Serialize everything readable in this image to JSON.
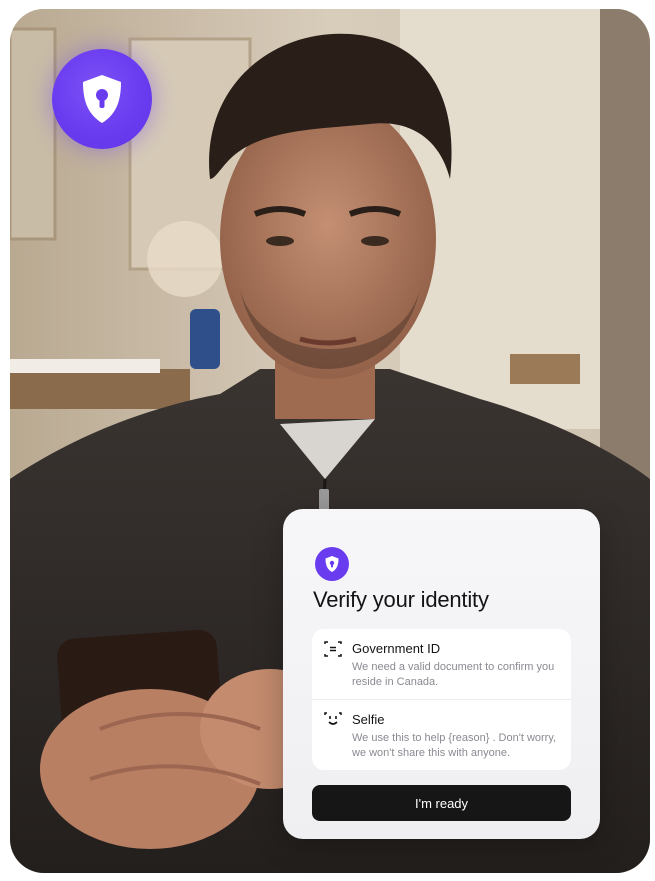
{
  "badge": {
    "icon": "shield-keyhole-icon",
    "color": "#6a3cf0"
  },
  "card": {
    "icon": "shield-keyhole-icon",
    "title": "Verify your identity",
    "items": [
      {
        "icon": "id-card-icon",
        "title": "Government ID",
        "description": "We need a valid document to confirm you reside in Canada."
      },
      {
        "icon": "selfie-face-icon",
        "title": "Selfie",
        "description": "We use this to help {reason} . Don't worry, we won't share this with anyone."
      }
    ],
    "cta_label": "I'm ready"
  },
  "colors": {
    "accent": "#6a3cf0",
    "cta_background": "#161616",
    "card_background": "#f3f3f5"
  }
}
